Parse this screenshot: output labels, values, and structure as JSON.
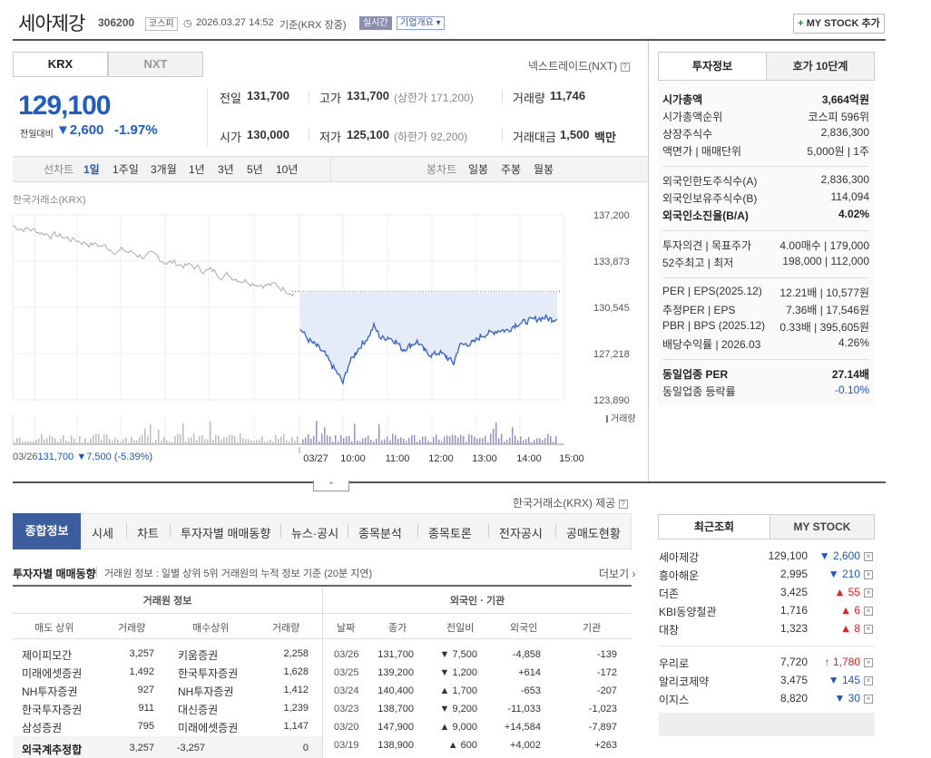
{
  "header": {
    "name": "세아제강",
    "code": "306200",
    "market": "코스피",
    "datetime": "2026.03.27 14:52",
    "basis": "기준(KRX 장중)",
    "realtime": "실시간",
    "overview": "기업개요",
    "mystock_btn": "MY STOCK 추가"
  },
  "tabs": [
    "KRX",
    "NXT"
  ],
  "nxt_link": "넥스트레이드(NXT)",
  "price": {
    "current": "129,100",
    "change_label": "전일대비",
    "change": "2,600",
    "change_pct": "-1.97%"
  },
  "quote": {
    "prev_label": "전일",
    "prev": "131,700",
    "high_label": "고가",
    "high": "131,700",
    "upper_label": "(상한가 171,200)",
    "vol_label": "거래량",
    "vol": "11,746",
    "open_label": "시가",
    "open": "130,000",
    "low_label": "저가",
    "low": "125,100",
    "lower_label": "(하한가 92,200)",
    "amt_label": "거래대금",
    "amt": "1,500",
    "amt_unit": "백만"
  },
  "periods": {
    "line_label": "선차트",
    "items": [
      "1일",
      "1주일",
      "3개월",
      "1년",
      "3년",
      "5년",
      "10년"
    ],
    "candle_label": "봉차트",
    "candles": [
      "일봉",
      "주봉",
      "월봉"
    ]
  },
  "chart_source": "한국거래소(KRX)",
  "chart_data": {
    "type": "line",
    "yticks": [
      "137,200",
      "133,873",
      "130,545",
      "127,218",
      "123,890"
    ],
    "ylim": [
      123890,
      137200
    ],
    "xticks": [
      "03/27",
      "10:00",
      "11:00",
      "12:00",
      "13:00",
      "14:00",
      "15:00"
    ],
    "prev_close": 131700,
    "volume_label": "거래량",
    "prev_day_label": "03/26",
    "prev_day_price": "131,700",
    "prev_day_change": "▼7,500",
    "prev_day_pct": "(-5.39%)"
  },
  "provider": "한국거래소(KRX) 제공",
  "menu": [
    "종합정보",
    "시세",
    "차트",
    "투자자별 매매동향",
    "뉴스·공시",
    "종목분석",
    "종목토론",
    "전자공시",
    "공매도현황"
  ],
  "trading": {
    "title": "투자자별 매매동향",
    "desc": "거래원 정보 : 일별 상위 5위 거래원의 누적 정보 기준 (20분 지연)",
    "more": "더보기",
    "group1": "거래원 정보",
    "group2": "외국인 · 기관",
    "headers1": [
      "매도 상위",
      "거래량",
      "매수상위",
      "거래량"
    ],
    "headers2": [
      "날짜",
      "종가",
      "전일비",
      "외국인",
      "기관"
    ],
    "brokers": [
      [
        "제이피모간",
        "3,257",
        "키움증권",
        "2,258"
      ],
      [
        "미래에셋증권",
        "1,492",
        "한국투자증권",
        "1,628"
      ],
      [
        "NH투자증권",
        "927",
        "NH투자증권",
        "1,412"
      ],
      [
        "한국투자증권",
        "911",
        "대신증권",
        "1,239"
      ],
      [
        "삼성증권",
        "795",
        "미래에셋증권",
        "1,147"
      ]
    ],
    "foreign_total": [
      "외국계추정합",
      "3,257",
      "-3,257",
      "0"
    ],
    "daily": [
      [
        "03/26",
        "131,700",
        "▼ 7,500",
        "-4,858",
        "-139"
      ],
      [
        "03/25",
        "139,200",
        "▼ 1,200",
        "+614",
        "-172"
      ],
      [
        "03/24",
        "140,400",
        "▲ 1,700",
        "-653",
        "-207"
      ],
      [
        "03/23",
        "138,700",
        "▼ 9,200",
        "-11,033",
        "-1,023"
      ],
      [
        "03/20",
        "147,900",
        "▲ 9,000",
        "+14,584",
        "-7,897"
      ],
      [
        "03/19",
        "138,900",
        "▲ 600",
        "+4,002",
        "+263"
      ]
    ]
  },
  "invest": {
    "tabs": [
      "투자정보",
      "호가 10단계"
    ],
    "rows1": [
      [
        "시가총액",
        "3,664억원"
      ],
      [
        "시가총액순위",
        "코스피 596위"
      ],
      [
        "상장주식수",
        "2,836,300"
      ],
      [
        "액면가 | 매매단위",
        "5,000원 | 1주"
      ]
    ],
    "rows2": [
      [
        "외국인한도주식수(A)",
        "2,836,300"
      ],
      [
        "외국인보유주식수(B)",
        "114,094"
      ],
      [
        "외국인소진율(B/A)",
        "4.02%"
      ]
    ],
    "rows3": [
      [
        "투자의견 | 목표주가",
        "4.00매수 | 179,000"
      ],
      [
        "52주최고 | 최저",
        "198,000 | 112,000"
      ]
    ],
    "rows4": [
      [
        "PER | EPS(2025.12)",
        "12.21배 | 10,577원"
      ],
      [
        "추정PER | EPS",
        "7.36배 | 17,546원"
      ],
      [
        "PBR | BPS (2025.12)",
        "0.33배 | 395,605원"
      ],
      [
        "배당수익률 | 2026.03",
        "4.26%"
      ]
    ],
    "rows5": [
      [
        "동일업종 PER",
        "27.14배"
      ],
      [
        "동일업종 등락률",
        "-0.10%"
      ]
    ]
  },
  "recent": {
    "tabs": [
      "최근조회",
      "MY STOCK"
    ],
    "items": [
      [
        "세아제강",
        "129,100",
        "▼ 2,600"
      ],
      [
        "흥아해운",
        "2,995",
        "▼ 210"
      ],
      [
        "더존",
        "3,425",
        "▲ 55"
      ],
      [
        "KBI동양철관",
        "1,716",
        "▲ 6"
      ],
      [
        "대창",
        "1,323",
        "▲ 8"
      ],
      [
        "우리로",
        "7,720",
        "↑ 1,780"
      ],
      [
        "알리코제약",
        "3,475",
        "▼ 145"
      ],
      [
        "이지스",
        "8,820",
        "▼ 30"
      ]
    ]
  }
}
